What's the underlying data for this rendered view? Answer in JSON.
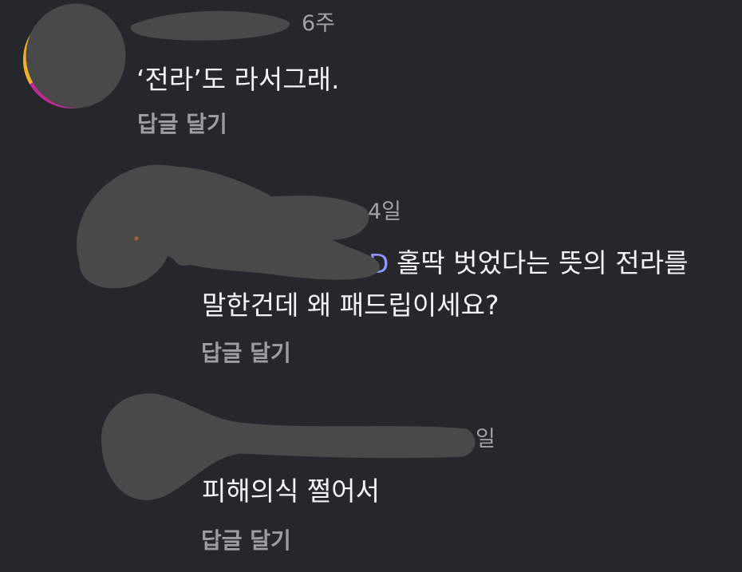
{
  "comments": [
    {
      "time": "6주",
      "text": "‘전라’도 라서그래.",
      "reply_label": "답글 달기"
    },
    {
      "time": "4일",
      "mention_fragment": "D",
      "text_line1": "홀딱 벗었다는 뜻의 전라를",
      "text_line2": "말한건데 왜 패드립이세요?",
      "reply_label": "답글 달기"
    },
    {
      "time": "일",
      "text": "피해의식 쩔어서",
      "reply_label": "답글 달기"
    }
  ]
}
